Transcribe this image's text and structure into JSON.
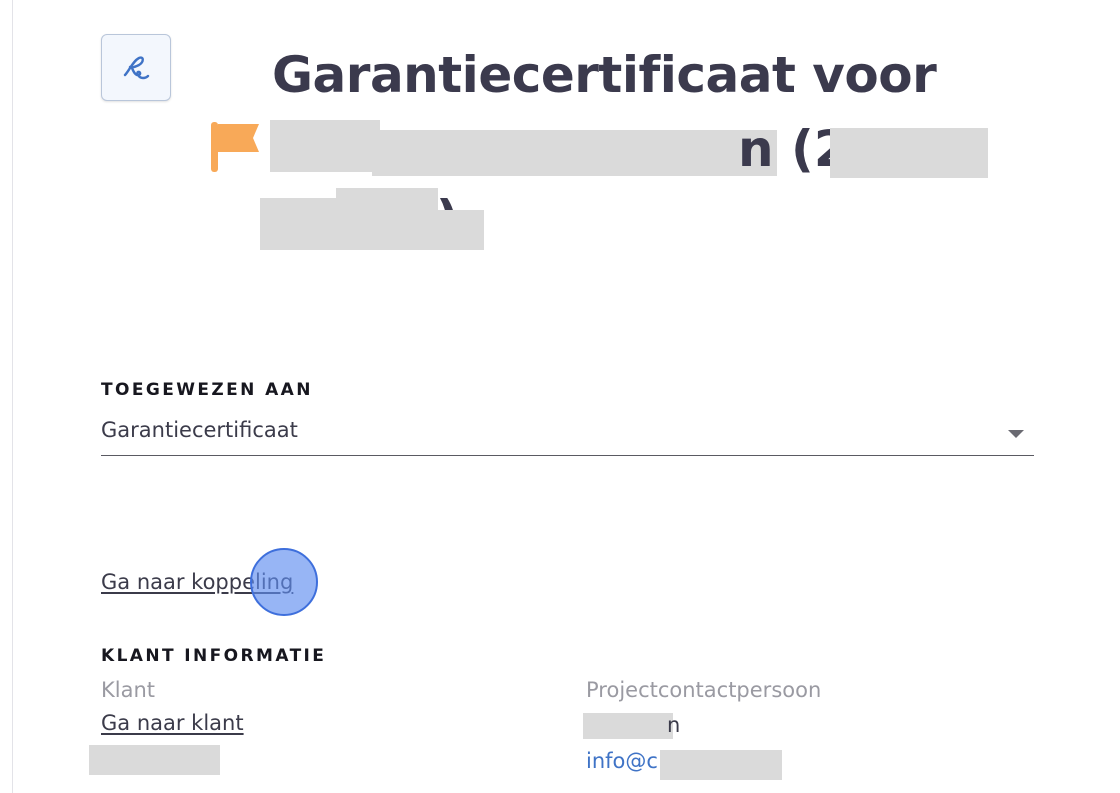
{
  "header": {
    "title": "Garantiecertificaat voor",
    "title_line2_fragment": "n (2",
    "title_line3_fragment": ")",
    "signature_icon": "signature-icon",
    "flag_icon": "flag-icon",
    "flag_color": "#f8a958"
  },
  "assignment": {
    "label": "TOEGEWEZEN AAN",
    "selected_value": "Garantiecertificaat",
    "goto_link": "Ga naar koppeling"
  },
  "customer_info": {
    "label": "KLANT INFORMATIE",
    "klant_label": "Klant",
    "goto_customer_link": "Ga naar klant",
    "contact_label": "Projectcontactpersoon",
    "contact_name_fragment": "n",
    "contact_email_fragment": "info@c"
  },
  "colors": {
    "title": "#3b3a4d",
    "link_blue": "#3f73c6",
    "click_marker": "#608ef0"
  }
}
